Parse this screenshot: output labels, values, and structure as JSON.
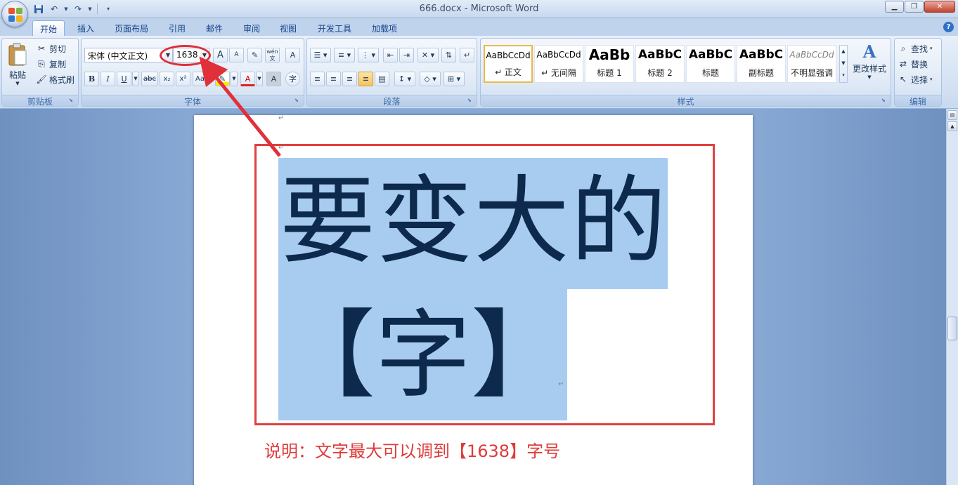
{
  "window": {
    "title": "666.docx - Microsoft Word"
  },
  "colors": {
    "selection": "#a8ccef",
    "annotation_red": "#e03a3a",
    "ribbon_accent": "#15428b"
  },
  "tabs": [
    {
      "label": "开始",
      "active": true
    },
    {
      "label": "插入"
    },
    {
      "label": "页面布局"
    },
    {
      "label": "引用"
    },
    {
      "label": "邮件"
    },
    {
      "label": "审阅"
    },
    {
      "label": "视图"
    },
    {
      "label": "开发工具"
    },
    {
      "label": "加载项"
    }
  ],
  "clipboard": {
    "paste_label": "粘贴",
    "cut_label": "剪切",
    "copy_label": "复制",
    "format_painter_label": "格式刷",
    "group_label": "剪贴板"
  },
  "font": {
    "font_name": "宋体 (中文正文)",
    "font_size": "1638",
    "group_label": "字体",
    "grow_label": "A",
    "shrink_label": "A",
    "bold_label": "B",
    "italic_label": "I",
    "underline_label": "U",
    "strike_label": "abc",
    "sub_label": "x₂",
    "sup_label": "x²",
    "case_label": "Aa",
    "pinyin_label": "wén",
    "color_label": "A"
  },
  "paragraph": {
    "group_label": "段落"
  },
  "styles": {
    "group_label": "样式",
    "items": [
      {
        "sample": "AaBbCcDd",
        "name": "↵ 正文",
        "active": true
      },
      {
        "sample": "AaBbCcDd",
        "name": "↵ 无间隔"
      },
      {
        "sample": "AaBb",
        "name": "标题 1"
      },
      {
        "sample": "AaBbC",
        "name": "标题 2"
      },
      {
        "sample": "AaBbC",
        "name": "标题"
      },
      {
        "sample": "AaBbC",
        "name": "副标题"
      },
      {
        "sample": "AaBbCcDd",
        "name": "不明显强调"
      }
    ],
    "change_styles_label": "更改样式"
  },
  "editing": {
    "group_label": "编辑",
    "find_label": "查找",
    "replace_label": "替换",
    "select_label": "选择"
  },
  "document": {
    "line1": "要变大的",
    "line2": "【字】",
    "para_mark": "↵",
    "caption": "说明：文字最大可以调到【1638】字号"
  }
}
